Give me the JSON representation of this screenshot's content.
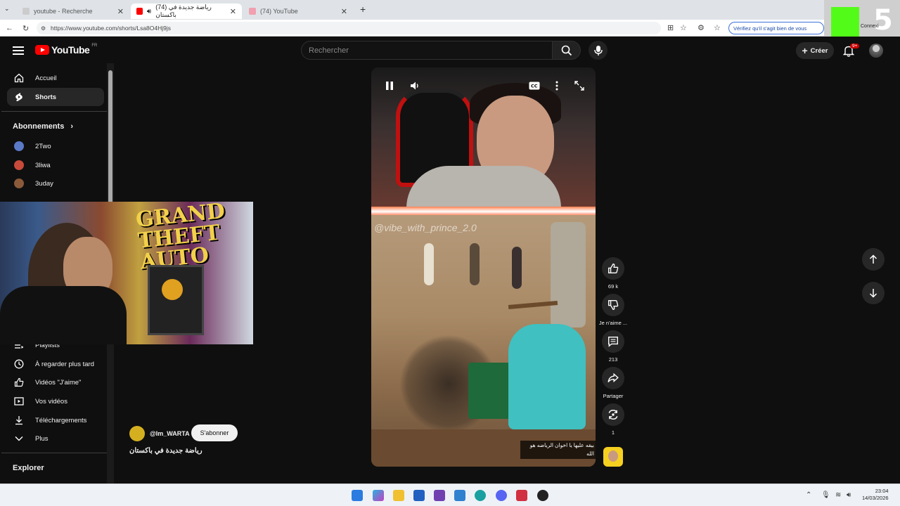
{
  "browser": {
    "tabs": [
      {
        "label": "youtube - Recherche",
        "active": false,
        "favicon": "search-tab-icon"
      },
      {
        "label": "(74) رياضة جديدة في باكستان",
        "active": true,
        "favicon": "youtube-tab-icon"
      },
      {
        "label": "(74) YouTube",
        "active": false,
        "favicon": "youtube-tab-icon"
      }
    ],
    "url": "https://www.youtube.com/shorts/Lsa8O4Hj9js",
    "verify_text": "Vérifiez qu'il s'agit bien de vous",
    "kick_overlay": {
      "number": "5",
      "text": "Connexi"
    }
  },
  "youtube": {
    "logo_text": "YouTube",
    "logo_country": "FR",
    "search_placeholder": "Rechercher",
    "create_label": "Créer",
    "notifications_badge": "9+",
    "sidebar": {
      "nav": [
        {
          "label": "Accueil",
          "icon": "home-icon",
          "active": false
        },
        {
          "label": "Shorts",
          "icon": "shorts-icon",
          "active": true
        }
      ],
      "subscriptions_title": "Abonnements",
      "subscriptions": [
        {
          "label": "2Two",
          "color": "#5a7ac8"
        },
        {
          "label": "3liwa",
          "color": "#c84a3a"
        },
        {
          "label": "3uday",
          "color": "#8a5a3a"
        }
      ],
      "you_items": [
        {
          "label": "Playlists",
          "icon": "playlist-icon"
        },
        {
          "label": "À regarder plus tard",
          "icon": "clock-icon"
        },
        {
          "label": "Vidéos \"J'aime\"",
          "icon": "thumbs-up-icon"
        },
        {
          "label": "Vos vidéos",
          "icon": "video-icon"
        },
        {
          "label": "Téléchargements",
          "icon": "download-icon"
        },
        {
          "label": "Plus",
          "icon": "chevron-down-icon"
        }
      ],
      "explore_title": "Explorer"
    },
    "short": {
      "watermark": "@vibe_with_prince_2.0",
      "caption": "بيقه عليها يا اخوان الرياضه هو الله",
      "channel_handle": "@Im_WARTA",
      "subscribe_label": "S'abonner",
      "title": "رياضة جديدة في باكستان",
      "actions": {
        "likes": "69 k",
        "dislike_label": "Je n'aime ...",
        "comments": "213",
        "share_label": "Partager",
        "remix_count": "1"
      }
    }
  },
  "taskbar": {
    "time": "23:04",
    "date": "14/03/2026"
  }
}
